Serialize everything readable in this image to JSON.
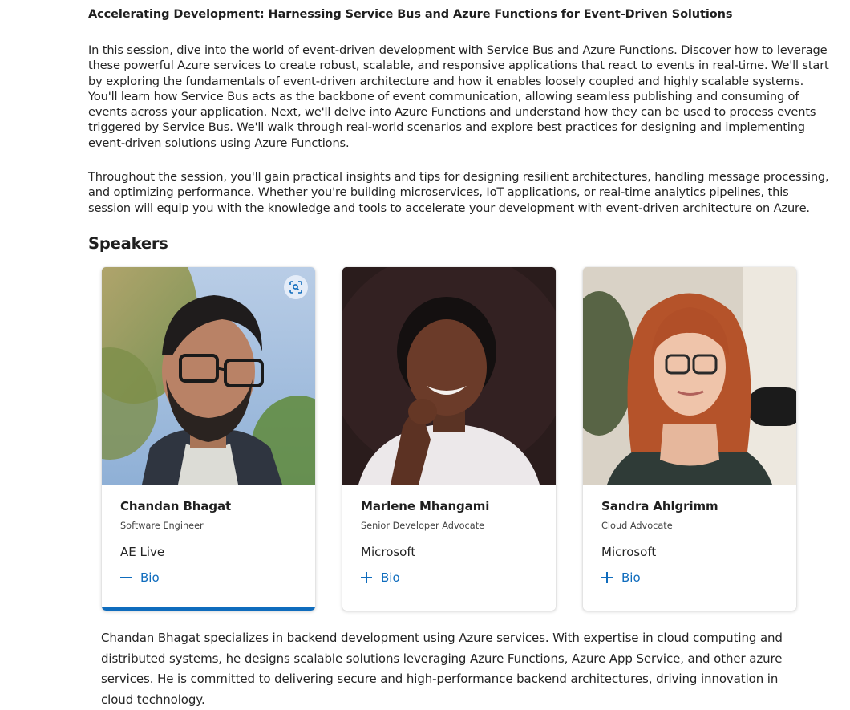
{
  "session": {
    "title": "Accelerating Development: Harnessing Service Bus and Azure Functions for Event-Driven Solutions",
    "description_1": "In this session, dive into the world of event-driven development with Service Bus and Azure Functions. Discover how to leverage these powerful Azure services to create robust, scalable, and responsive applications that react to events in real-time. We'll start by exploring the fundamentals of event-driven architecture and how it enables loosely coupled and highly scalable systems. You'll learn how Service Bus acts as the backbone of event communication, allowing seamless publishing and consuming of events across your application. Next, we'll delve into Azure Functions and understand how they can be used to process events triggered by Service Bus. We'll walk through real-world scenarios and explore best practices for designing and implementing event-driven solutions using Azure Functions.",
    "description_2": "Throughout the session, you'll gain practical insights and tips for designing resilient architectures, handling message processing, and optimizing performance. Whether you're building microservices, IoT applications, or real-time analytics pipelines, this session will equip you with the knowledge and tools to accelerate your development with event-driven architecture on Azure."
  },
  "speakers_heading": "Speakers",
  "speakers": [
    {
      "name": "Chandan Bhagat",
      "role": "Software Engineer",
      "company": "AE Live",
      "bio_label": "Bio",
      "bio_icon": "minus-icon",
      "expanded": true
    },
    {
      "name": "Marlene Mhangami",
      "role": "Senior Developer Advocate",
      "company": "Microsoft",
      "bio_label": "Bio",
      "bio_icon": "plus-icon",
      "expanded": false
    },
    {
      "name": "Sandra Ahlgrimm",
      "role": "Cloud Advocate",
      "company": "Microsoft",
      "bio_label": "Bio",
      "bio_icon": "plus-icon",
      "expanded": false
    }
  ],
  "expanded_bio": "Chandan Bhagat specializes in backend development using Azure services. With expertise in cloud computing and distributed systems, he designs scalable solutions leveraging Azure Functions, Azure App Service, and other azure services. He is committed to delivering secure and high-performance backend architectures, driving innovation in cloud technology.",
  "colors": {
    "accent": "#0f6cbd",
    "text": "#242424",
    "background": "#ffffff"
  },
  "icons": {
    "visual_search": "visual-search-icon",
    "expand": "plus-icon",
    "collapse": "minus-icon"
  }
}
